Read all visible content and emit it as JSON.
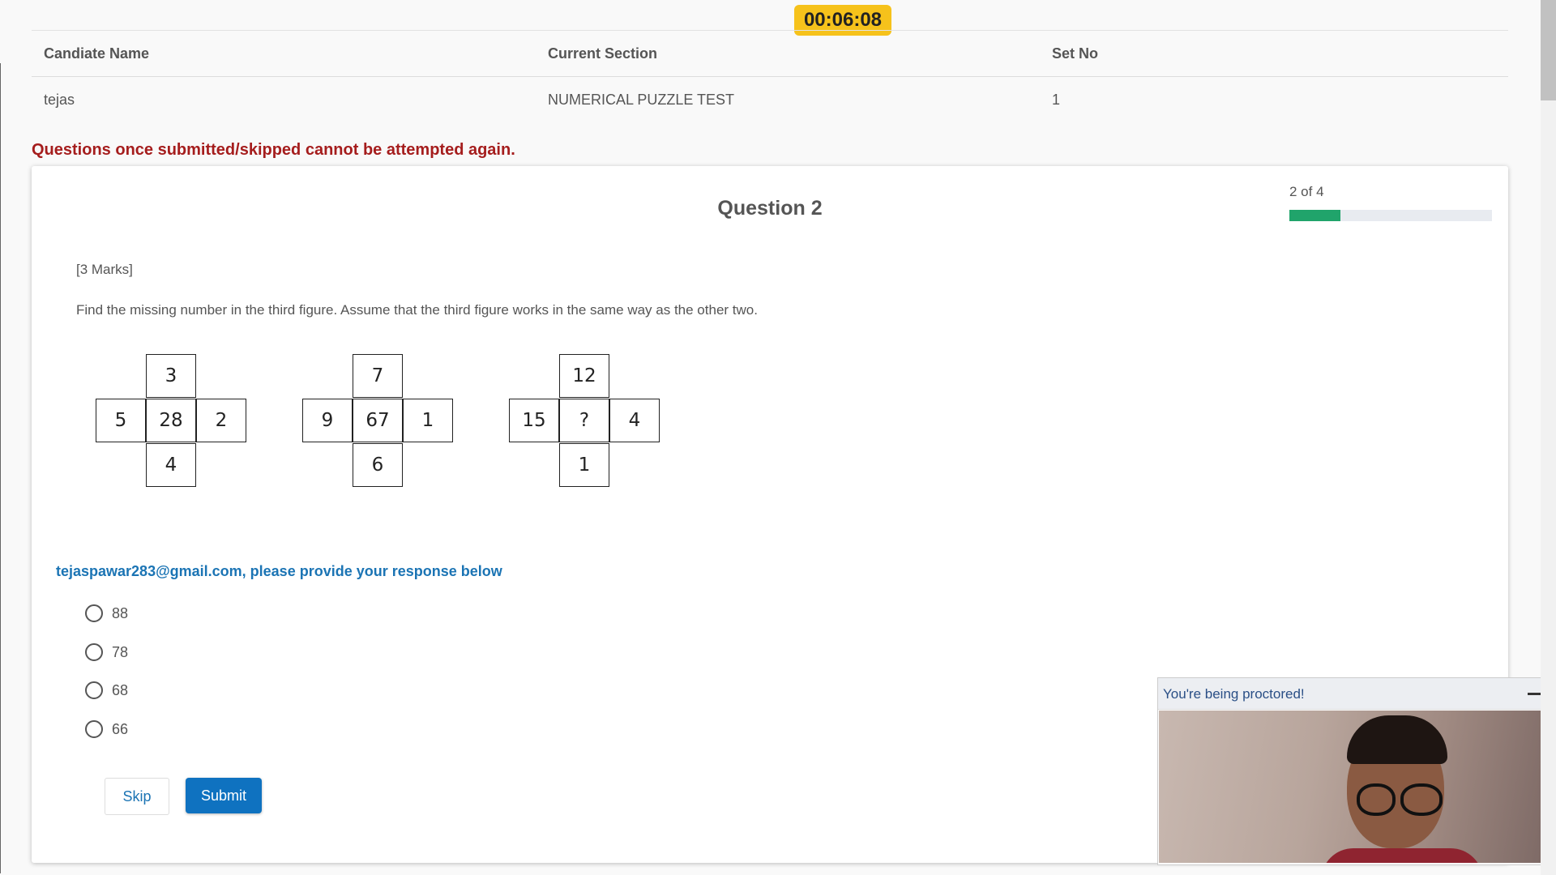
{
  "timer": "00:06:08",
  "info_table": {
    "headers": [
      "Candiate Name",
      "Current Section",
      "Set No"
    ],
    "values": [
      "tejas",
      "NUMERICAL PUZZLE TEST",
      "1"
    ]
  },
  "warning": "Questions once submitted/skipped cannot be attempted again.",
  "question": {
    "title": "Question 2",
    "progress_label": "2 of 4",
    "progress_fraction": 0.25,
    "marks": "[3 Marks]",
    "prompt": "Find the missing number in the third figure. Assume that the third figure works in the same way as the other two.",
    "figures": [
      {
        "top": "3",
        "left": "5",
        "center": "28",
        "right": "2",
        "bottom": "4"
      },
      {
        "top": "7",
        "left": "9",
        "center": "67",
        "right": "1",
        "bottom": "6"
      },
      {
        "top": "12",
        "left": "15",
        "center": "?",
        "right": "4",
        "bottom": "1"
      }
    ]
  },
  "response": {
    "label": "tejaspawar283@gmail.com, please provide your response below",
    "options": [
      "88",
      "78",
      "68",
      "66"
    ]
  },
  "buttons": {
    "skip": "Skip",
    "submit": "Submit"
  },
  "proctor": {
    "title": "You're being proctored!"
  },
  "colors": {
    "timer_bg": "#f6c21b",
    "warning": "#a51d1d",
    "progress_fill": "#20a46b",
    "accent_blue": "#0f72c0"
  }
}
